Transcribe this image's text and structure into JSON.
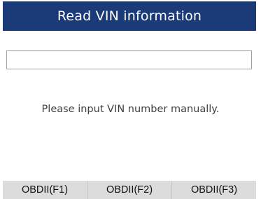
{
  "header": {
    "title": "Read VIN information"
  },
  "vin_field": {
    "value": "",
    "placeholder": ""
  },
  "message": "Please input VIN number manually.",
  "function_keys": [
    {
      "label": "OBDII(F1)"
    },
    {
      "label": "OBDII(F2)"
    },
    {
      "label": "OBDII(F3)"
    }
  ],
  "colors": {
    "title_bar": "#1a3a78",
    "footer_bar": "#dcdcdc",
    "text": "#3f3f3f"
  }
}
